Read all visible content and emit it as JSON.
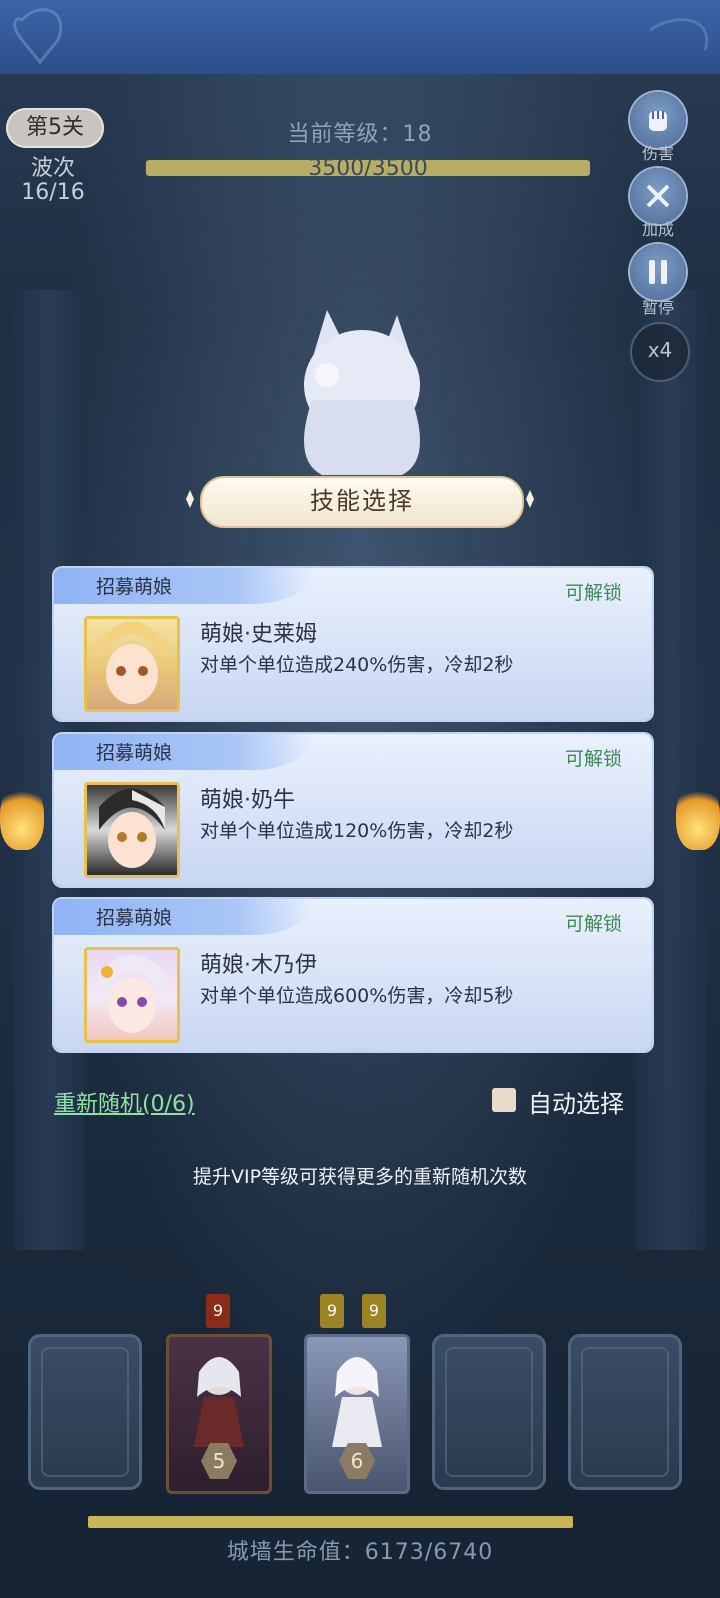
{
  "hud": {
    "stage": "第5关",
    "wave_label": "波次",
    "wave_value": "16/16",
    "level_text": "当前等级：18",
    "hp_text": "3500/3500",
    "damage_label": "伤害",
    "buff_label": "加成",
    "pause_label": "暂停",
    "speed": "x4"
  },
  "dialog": {
    "title": "技能选择",
    "cards": [
      {
        "tag": "招募萌娘",
        "status": "可解锁",
        "name": "萌娘·史莱姆",
        "desc": "对单个单位造成240%伤害，冷却2秒"
      },
      {
        "tag": "招募萌娘",
        "status": "可解锁",
        "name": "萌娘·奶牛",
        "desc": "对单个单位造成120%伤害，冷却2秒"
      },
      {
        "tag": "招募萌娘",
        "status": "可解锁",
        "name": "萌娘·木乃伊",
        "desc": "对单个单位造成600%伤害，冷却5秒"
      }
    ],
    "reroll": "重新随机(0/6)",
    "auto_select": "自动选择",
    "tip": "提升VIP等级可获得更多的重新随机次数"
  },
  "bottom": {
    "badges": [
      "9",
      "9",
      "9"
    ],
    "hero_levels": [
      "5",
      "6"
    ],
    "wall_text": "城墙生命值：6173/6740",
    "wall_hp_fraction": 0.916
  },
  "colors": {
    "unlock_green": "#3f8a55",
    "reroll_green": "#8ee3a4",
    "card_bg": "#dbe6f9"
  }
}
